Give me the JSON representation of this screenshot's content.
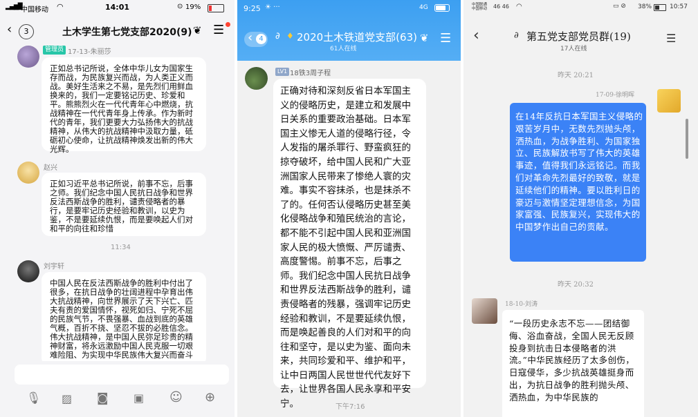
{
  "panel1": {
    "status": {
      "carrier": "中国移动",
      "time": "14:01",
      "battery": "19%"
    },
    "back_count": "3",
    "title": "土木学生第七党支部2020(9)",
    "messages": [
      {
        "badge": "管理员",
        "name": "17-13-朱丽莎",
        "text": "正如总书记所说，全体中华儿女为国家生存而战，为民族复兴而战，为人类正义而战。美好生活来之不易，是先烈们用鲜血换来的，我们一定要铭记历史、珍爱和平。熊熊烈火在一代代青年心中燃烧，抗战精神在一代代青年身上传承。作为新时代的青年，我们更要大力弘扬伟大的抗战精神，从伟大的抗战精神中汲取力量，砥砺初心使命，让抗战精神焕发出新的伟大光辉。"
      },
      {
        "name": "赵兴",
        "text": "正如习近平总书记所说，前事不忘，后事之师。我们纪念中国人民抗日战争和世界反法西斯战争的胜利，谴责侵略者的暴行，是要牢记历史经验和教训，以史为鉴，不是要延续仇恨，而是要唤起人们对和平的向往和珍惜"
      },
      {
        "name": "刘宇轩",
        "text": "中国人民在反法西斯战争的胜利中付出了很多，在抗日战争的壮阔进程中孕育出伟大抗战精神，向世界展示了天下兴亡、匹夫有责的爱国情怀，视死如归、宁死不屈的民族气节，不畏强暴、血战到底的英雄气概，百折不挠、坚忍不拔的必胜信念。伟大抗战精神，是中国人民弥足珍贵的精神财富，将永远激励中国人民克服一切艰难险阻、为实现中华民族伟大复兴而奋斗"
      }
    ],
    "time_divider": "11:34"
  },
  "panel2": {
    "status": {
      "time": "9:25",
      "network": "4G"
    },
    "back_count": "4",
    "title": "2020土木铁道党支部(63)",
    "online": "61人在线",
    "message": {
      "badge": "LV1",
      "name": "18铁3周子程",
      "text": "正确对待和深刻反省日本军国主义的侵略历史，是建立和发展中日关系的重要政治基础。日本军国主义惨无人道的侵略行径，令人发指的屠杀罪行、野蛮疯狂的掠夺破坏，给中国人民和广大亚洲国家人民带来了惨绝人寰的灾难。事实不容抹杀，也是抹杀不了的。任何否认侵略历史甚至美化侵略战争和殖民统治的言论，都不能不引起中国人民和亚洲国家人民的极大愤慨、严厉谴责、高度警惕。前事不忘，后事之师。我们纪念中国人民抗日战争和世界反法西斯战争的胜利，谴责侵略者的残暴，强调牢记历史经验和教训，不是要延续仇恨，而是唤起善良的人们对和平的向往和坚守，是以史为鉴、面向未来，共同珍爱和平、维护和平，让中日两国人民世世代代友好下去，让世界各国人民永享和平安宁。"
    },
    "time_divider": "下午7:16"
  },
  "panel3": {
    "status": {
      "carrier": "中国联通 中国移动",
      "signal": "46 46",
      "battery": "38%",
      "time": "10:57"
    },
    "title": "第五党支部党员群(19)",
    "online": "17人在线",
    "divider1": "昨天 20:21",
    "msg1": {
      "name": "17-09-徐明晖",
      "text": "在14年反抗日本军国主义侵略的艰苦岁月中，无数先烈抛头颅，洒热血，为战争胜利、为国家独立、民族解放书写了伟大的英雄事迹，值得我们永远铭记。而我们对革命先烈最好的致敬，就是延续他们的精神。要以胜利日的豪迈与激情坚定理想信念，为国家富强、民族复兴，实现伟大的中国梦作出自己的贡献。"
    },
    "divider2": "昨天 20:32",
    "msg2": {
      "name": "18-10-刘涛",
      "text": "“一段历史永志不忘——团结御侮、浴血奋战，全国人民无反顾投身到抗击日本侵略者的洪流。”中华民族经历了太多创伤，日寇侵华，多少抗战英雄挺身而出，为抗日战争的胜利抛头颅、洒热血，为中华民族的"
    }
  }
}
